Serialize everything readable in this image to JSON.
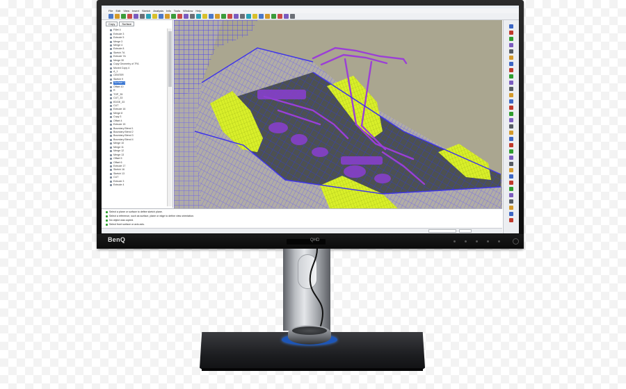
{
  "monitor": {
    "brand": "BenQ",
    "model": "QHD"
  },
  "app": {
    "menu": [
      "File",
      "Edit",
      "View",
      "Insert",
      "Sketch",
      "Analysis",
      "Info",
      "Tools",
      "Window",
      "Help"
    ],
    "tree_combos": [
      "Copy",
      "Surface"
    ],
    "tree_items": [
      "Fillet 4",
      "Extrude 3",
      "Extrude 5",
      "Merge 3",
      "Merge 4",
      "Extrude 8",
      "Sketch 7A",
      "Extrude 7A",
      "Merge 30",
      "Copy Geometry of 7FA",
      "Moved Copy 4",
      "A_1",
      "CENTER",
      "Sketch 9",
      "Surface 1",
      "Offset 10",
      "R",
      "TOP_35",
      "CUT_33",
      "EDGE_33",
      "CUT",
      "Extrude 16",
      "Merge 8",
      "Copy 3",
      "Offset 4",
      "Extrude 15",
      "Boundary Blend 1",
      "Boundary Blend 2",
      "Boundary Blend 3",
      "Boundary Blend 4",
      "Merge 10",
      "Merge 11",
      "Merge 12",
      "Merge 13",
      "Offset 5",
      "Offset 6",
      "Extrude 17",
      "Sketch 16",
      "Sketch 13",
      "CUT",
      "Extrude 3",
      "Extrude 4"
    ],
    "selected_index": 14,
    "messages": [
      "Select a plane or surface to define sketch plane.",
      "Select a reference, such as surface, plane or edge to define view orientation.",
      "No object was copied.",
      "Select front surface or axis axis."
    ]
  },
  "colors": {
    "wireframe_blue": "#4b3ff0",
    "wireframe_violet": "#9b3fd6",
    "highlight_yellow": "#d9ef2a",
    "viewport_bg": "#a9a58f",
    "stand_accent": "#1d56b8"
  },
  "icons": {
    "toolbar": "cad-tool-icons",
    "right_toolbar": "sketch-tool-icons"
  }
}
